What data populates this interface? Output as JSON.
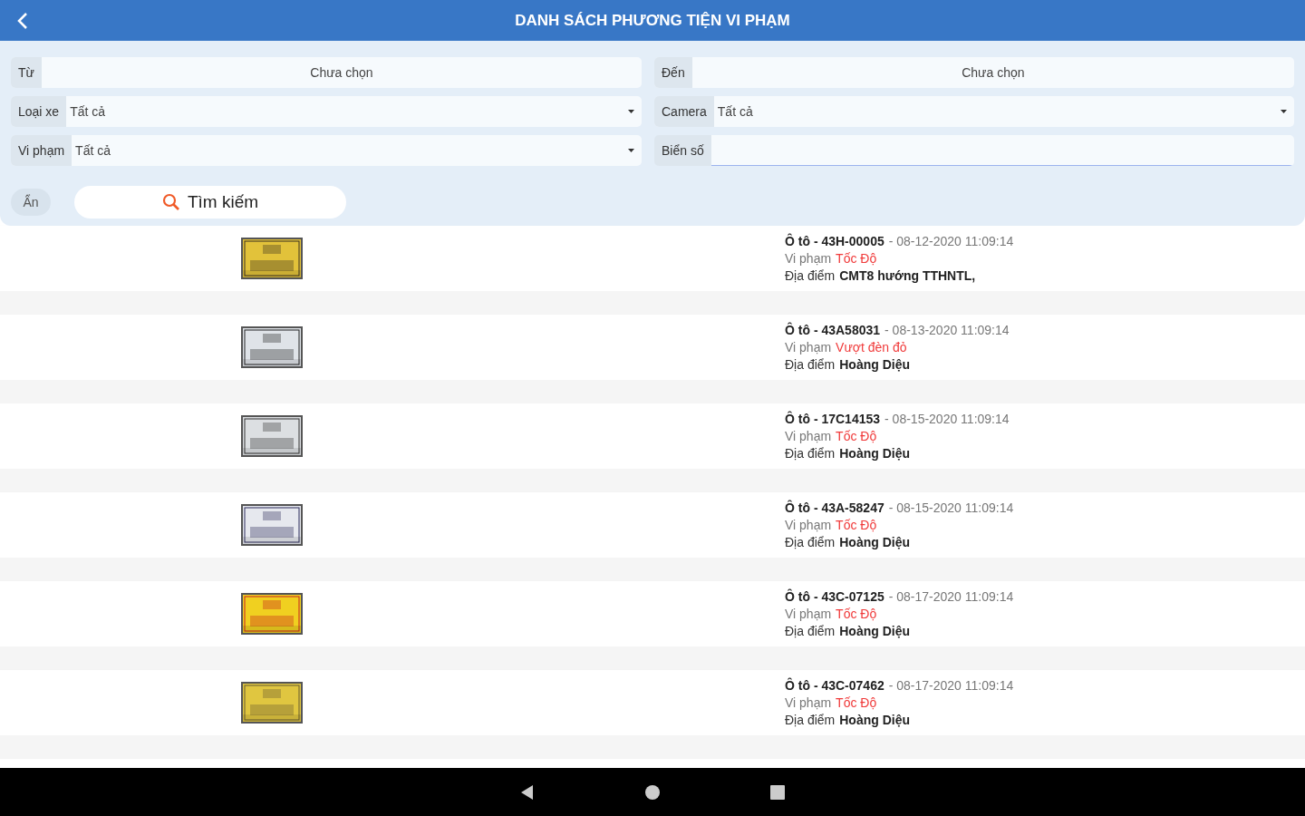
{
  "header": {
    "title": "DANH SÁCH PHƯƠNG TIỆN VI PHẠM"
  },
  "filters": [
    {
      "kind": "picker",
      "label": "Từ",
      "value": "Chưa chọn"
    },
    {
      "kind": "picker",
      "label": "Đến",
      "value": "Chưa chọn"
    },
    {
      "kind": "dropdown",
      "label": "Loại xe",
      "value": "Tất cả"
    },
    {
      "kind": "dropdown",
      "label": "Camera",
      "value": "Tất cả"
    },
    {
      "kind": "dropdown",
      "label": "Vi phạm",
      "value": "Tất cả"
    },
    {
      "kind": "text",
      "label": "Biển số"
    }
  ],
  "hide_button": "Ẩn",
  "search_button": "Tìm kiếm",
  "violations": [
    {
      "title": "Ô tô - 43H-00005",
      "time": "- 08-12-2020 11:09:14",
      "violation_label": "Vi phạm",
      "violation": "Tốc Độ",
      "location_label": "Địa điểm",
      "location": "CMT8 hướng TTHNTL,"
    },
    {
      "title": "Ô tô - 43A58031",
      "time": "- 08-13-2020 11:09:14",
      "violation_label": "Vi phạm",
      "violation": "Vượt đèn đỏ",
      "location_label": "Địa điểm",
      "location": "Hoàng Diệu"
    },
    {
      "title": "Ô tô - 17C14153",
      "time": "- 08-15-2020 11:09:14",
      "violation_label": "Vi phạm",
      "violation": "Tốc Độ",
      "location_label": "Địa điểm",
      "location": "Hoàng Diệu"
    },
    {
      "title": "Ô tô - 43A-58247",
      "time": "- 08-15-2020 11:09:14",
      "violation_label": "Vi phạm",
      "violation": "Tốc Độ",
      "location_label": "Địa điểm",
      "location": "Hoàng Diệu"
    },
    {
      "title": "Ô tô - 43C-07125",
      "time": "- 08-17-2020 11:09:14",
      "violation_label": "Vi phạm",
      "violation": "Tốc Độ",
      "location_label": "Địa điểm",
      "location": "Hoàng Diệu"
    },
    {
      "title": "Ô tô - 43C-07462",
      "time": "- 08-17-2020 11:09:14",
      "violation_label": "Vi phạm",
      "violation": "Tốc Độ",
      "location_label": "Địa điểm",
      "location": "Hoàng Diệu"
    }
  ]
}
